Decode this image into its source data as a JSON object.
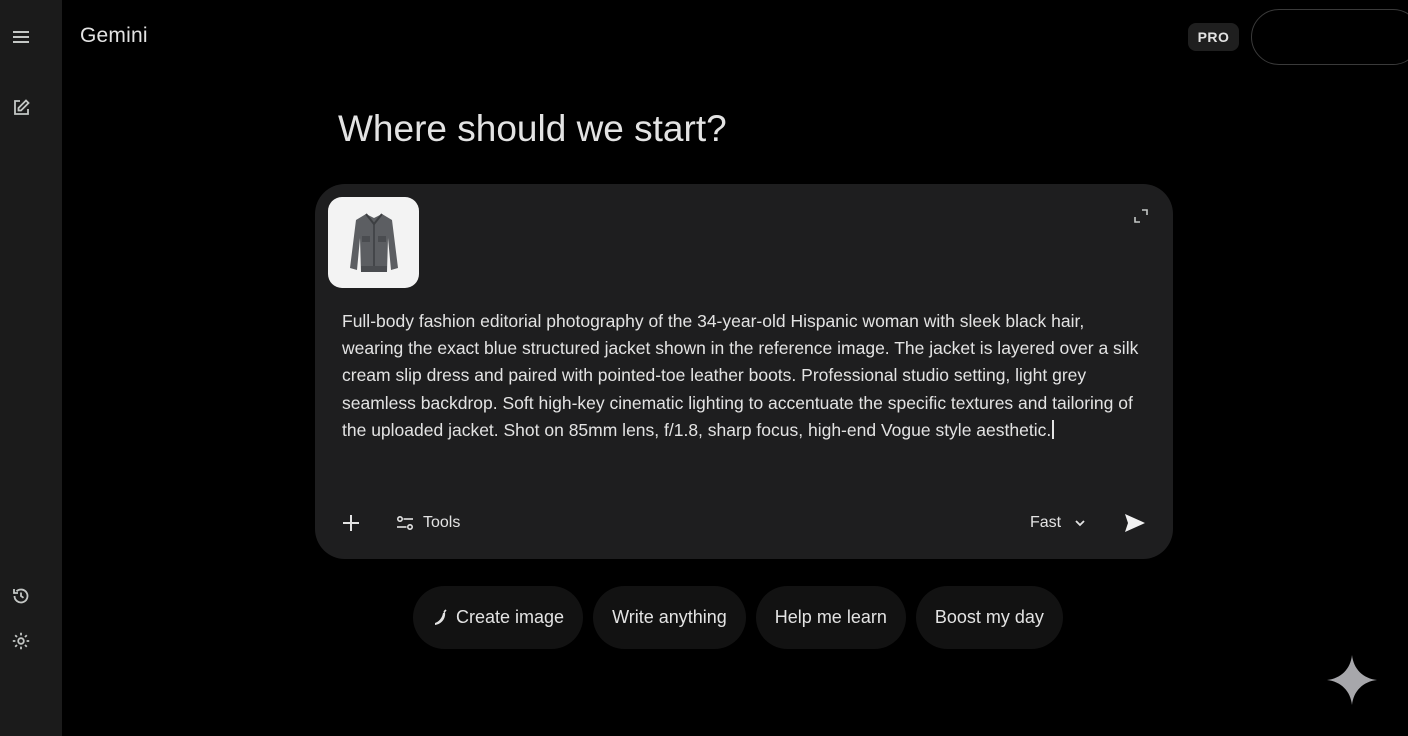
{
  "header": {
    "brand": "Gemini",
    "plan_badge": "PRO"
  },
  "rail": {
    "icons": [
      "menu-icon",
      "new-chat-icon",
      "history-icon",
      "settings-icon"
    ]
  },
  "main": {
    "greeting": "Where should we start?"
  },
  "composer": {
    "attachment_icon": "jacket-thumbnail",
    "prompt_text": "Full-body fashion editorial photography of the 34-year-old Hispanic woman with sleek black hair, wearing the exact blue structured jacket shown in the reference image. The jacket is layered over a silk cream slip dress and paired with pointed-toe leather boots. Professional studio setting, light grey seamless backdrop. Soft high-key cinematic lighting to accentuate the specific textures and tailoring of the uploaded jacket. Shot on 85mm lens, f/1.8, sharp focus, high-end Vogue style aesthetic.",
    "tools_label": "Tools",
    "model_label": "Fast"
  },
  "chips": [
    {
      "label": "Create image",
      "icon": "banana-icon"
    },
    {
      "label": "Write anything",
      "icon": ""
    },
    {
      "label": "Help me learn",
      "icon": ""
    },
    {
      "label": "Boost my day",
      "icon": ""
    }
  ],
  "colors": {
    "background": "#000000",
    "rail": "#1b1b1b",
    "card": "#1e1e1f",
    "chip": "#121212",
    "text": "#e3e3e3"
  }
}
